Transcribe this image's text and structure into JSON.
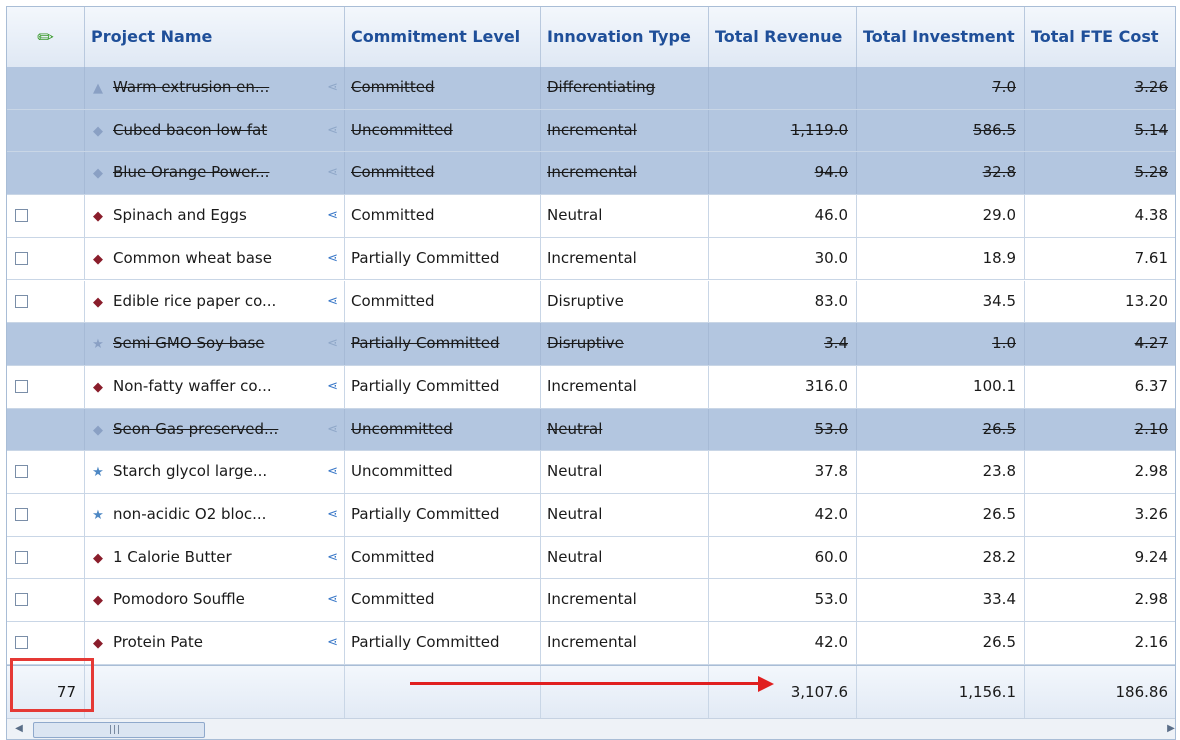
{
  "header": {
    "edit_icon": "pencil-icon",
    "columns": [
      "Project Name",
      "Commitment Level",
      "Innovation Type",
      "Total Revenue",
      "Total Investment",
      "Total FTE Cost"
    ]
  },
  "rows": [
    {
      "deleted": true,
      "icon": "triangle",
      "name": "Warm extrusion en...",
      "commitment": "Committed",
      "innovation": "Differentiating",
      "revenue": "",
      "investment": "7.0",
      "fte": "3.26"
    },
    {
      "deleted": true,
      "icon": "cube",
      "name": "Cubed bacon low fat",
      "commitment": "Uncommitted",
      "innovation": "Incremental",
      "revenue": "1,119.0",
      "investment": "586.5",
      "fte": "5.14"
    },
    {
      "deleted": true,
      "icon": "cube",
      "name": "Blue Orange Power...",
      "commitment": "Committed",
      "innovation": "Incremental",
      "revenue": "94.0",
      "investment": "32.8",
      "fte": "5.28"
    },
    {
      "deleted": false,
      "icon": "cube",
      "name": "Spinach and Eggs",
      "commitment": "Committed",
      "innovation": "Neutral",
      "revenue": "46.0",
      "investment": "29.0",
      "fte": "4.38"
    },
    {
      "deleted": false,
      "icon": "cube",
      "name": "Common wheat base",
      "commitment": "Partially Committed",
      "innovation": "Incremental",
      "revenue": "30.0",
      "investment": "18.9",
      "fte": "7.61"
    },
    {
      "deleted": false,
      "icon": "cube",
      "name": "Edible rice paper co...",
      "commitment": "Committed",
      "innovation": "Disruptive",
      "revenue": "83.0",
      "investment": "34.5",
      "fte": "13.20"
    },
    {
      "deleted": true,
      "icon": "star",
      "name": "Semi GMO Soy base",
      "commitment": "Partially Committed",
      "innovation": "Disruptive",
      "revenue": "3.4",
      "investment": "1.0",
      "fte": "4.27"
    },
    {
      "deleted": false,
      "icon": "cube",
      "name": "Non-fatty waffer co...",
      "commitment": "Partially Committed",
      "innovation": "Incremental",
      "revenue": "316.0",
      "investment": "100.1",
      "fte": "6.37"
    },
    {
      "deleted": true,
      "icon": "cube",
      "name": "Seon Gas preserved...",
      "commitment": "Uncommitted",
      "innovation": "Neutral",
      "revenue": "53.0",
      "investment": "26.5",
      "fte": "2.10"
    },
    {
      "deleted": false,
      "icon": "star",
      "name": "Starch glycol large...",
      "commitment": "Uncommitted",
      "innovation": "Neutral",
      "revenue": "37.8",
      "investment": "23.8",
      "fte": "2.98"
    },
    {
      "deleted": false,
      "icon": "star",
      "name": "non-acidic O2 bloc...",
      "commitment": "Partially Committed",
      "innovation": "Neutral",
      "revenue": "42.0",
      "investment": "26.5",
      "fte": "3.26"
    },
    {
      "deleted": false,
      "icon": "cube",
      "name": "1 Calorie Butter",
      "commitment": "Committed",
      "innovation": "Neutral",
      "revenue": "60.0",
      "investment": "28.2",
      "fte": "9.24"
    },
    {
      "deleted": false,
      "icon": "cube",
      "name": "Pomodoro Souffle",
      "commitment": "Committed",
      "innovation": "Incremental",
      "revenue": "53.0",
      "investment": "33.4",
      "fte": "2.98"
    },
    {
      "deleted": false,
      "icon": "cube",
      "name": "Protein Pate",
      "commitment": "Partially Committed",
      "innovation": "Incremental",
      "revenue": "42.0",
      "investment": "26.5",
      "fte": "2.16"
    }
  ],
  "footer": {
    "count": "77",
    "total_revenue": "3,107.6",
    "total_investment": "1,156.1",
    "total_fte": "186.86"
  },
  "colors": {
    "deleted_row_bg": "#b3c6e0",
    "header_text": "#1f4f99",
    "annotation_red": "#e01f1f"
  }
}
